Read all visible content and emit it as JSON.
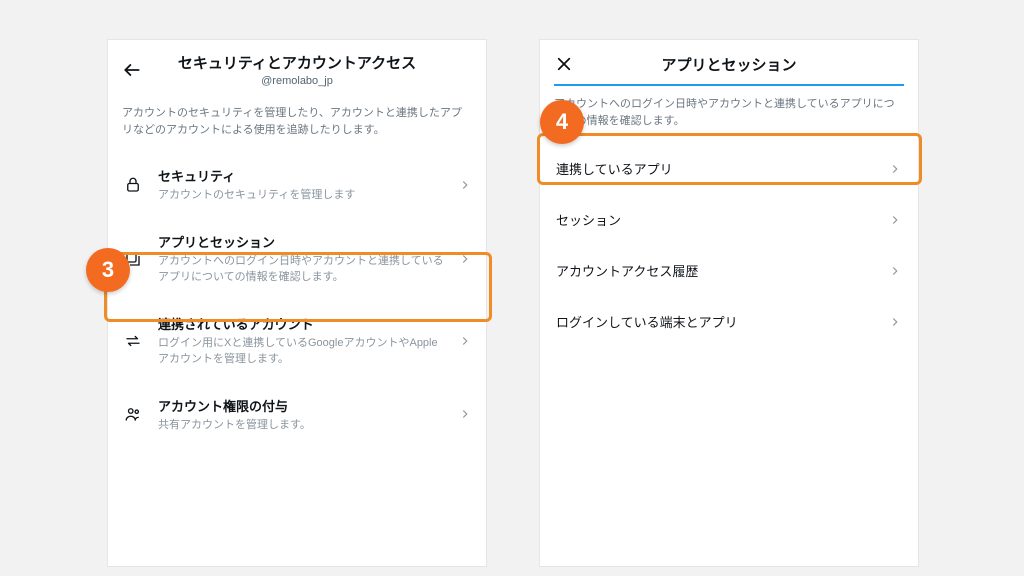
{
  "left": {
    "title": "セキュリティとアカウントアクセス",
    "subtitle": "@remolabo_jp",
    "intro": "アカウントのセキュリティを管理したり、アカウントと連携したアプリなどのアカウントによる使用を追跡したりします。",
    "items": [
      {
        "title": "セキュリティ",
        "desc": "アカウントのセキュリティを管理します"
      },
      {
        "title": "アプリとセッション",
        "desc": "アカウントへのログイン日時やアカウントと連携しているアプリについての情報を確認します。"
      },
      {
        "title": "連携されているアカウント",
        "desc": "ログイン用にXと連携しているGoogleアカウントやAppleアカウントを管理します。"
      },
      {
        "title": "アカウント権限の付与",
        "desc": "共有アカウントを管理します。"
      }
    ]
  },
  "right": {
    "title": "アプリとセッション",
    "intro": "アカウントへのログイン日時やアカウントと連携しているアプリについての情報を確認します。",
    "rows": [
      {
        "label": "連携しているアプリ"
      },
      {
        "label": "セッション"
      },
      {
        "label": "アカウントアクセス履歴"
      },
      {
        "label": "ログインしている端末とアプリ"
      }
    ]
  },
  "steps": {
    "s3": "3",
    "s4": "4"
  }
}
